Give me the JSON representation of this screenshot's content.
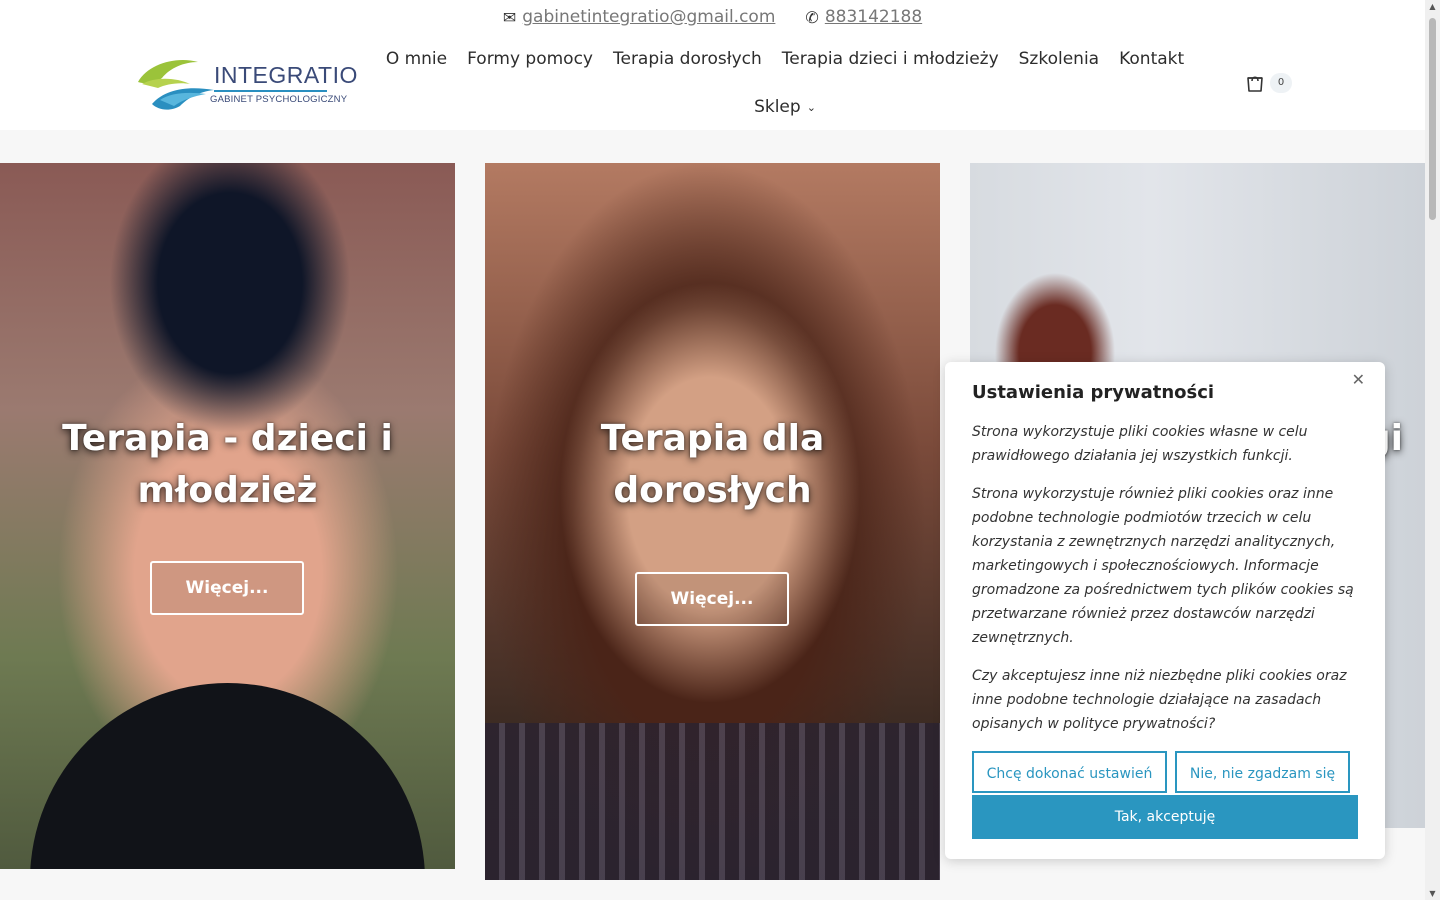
{
  "topbar": {
    "email_icon": "envelope-icon",
    "email": "gabinetintegratio@gmail.com",
    "phone_icon": "phone-icon",
    "phone": "883142188"
  },
  "header": {
    "logo_brand": "INTEGRATIO",
    "logo_tagline": "GABINET PSYCHOLOGICZNY",
    "nav": [
      "O mnie",
      "Formy pomocy",
      "Terapia dorosłych",
      "Terapia dzieci i młodzieży",
      "Szkolenia",
      "Kontakt"
    ],
    "shop_label": "Sklep",
    "cart_icon": "shopping-bag-icon",
    "cart_count": "0"
  },
  "cards": [
    {
      "title": "Terapia - dzieci i młodzież",
      "button": "Więcej..."
    },
    {
      "title": "Terapia dla dorosłych",
      "button": "Więcej..."
    },
    {
      "title": "gi",
      "button": ""
    }
  ],
  "cookie": {
    "title": "Ustawienia prywatności",
    "close_icon": "close-icon",
    "paragraphs": [
      "Strona wykorzystuje pliki cookies własne w celu prawidłowego działania jej wszystkich funkcji.",
      "Strona wykorzystuje również pliki cookies oraz inne podobne technologie podmiotów trzecich w celu korzystania z zewnętrznych narzędzi analitycznych, marketingowych i społecznościowych. Informacje gromadzone za pośrednictwem tych plików cookies są przetwarzane również przez dostawców narzędzi zewnętrznych.",
      "Czy akceptujesz inne niż niezbędne pliki cookies oraz inne podobne technologie działające na zasadach opisanych w polityce prywatności?"
    ],
    "settings_button": "Chcę dokonać ustawień",
    "decline_button": "Nie, nie zgadzam się",
    "accept_button": "Tak, akceptuję"
  },
  "colors": {
    "accent": "#2a96c0",
    "brand_text": "#3a4a78"
  }
}
